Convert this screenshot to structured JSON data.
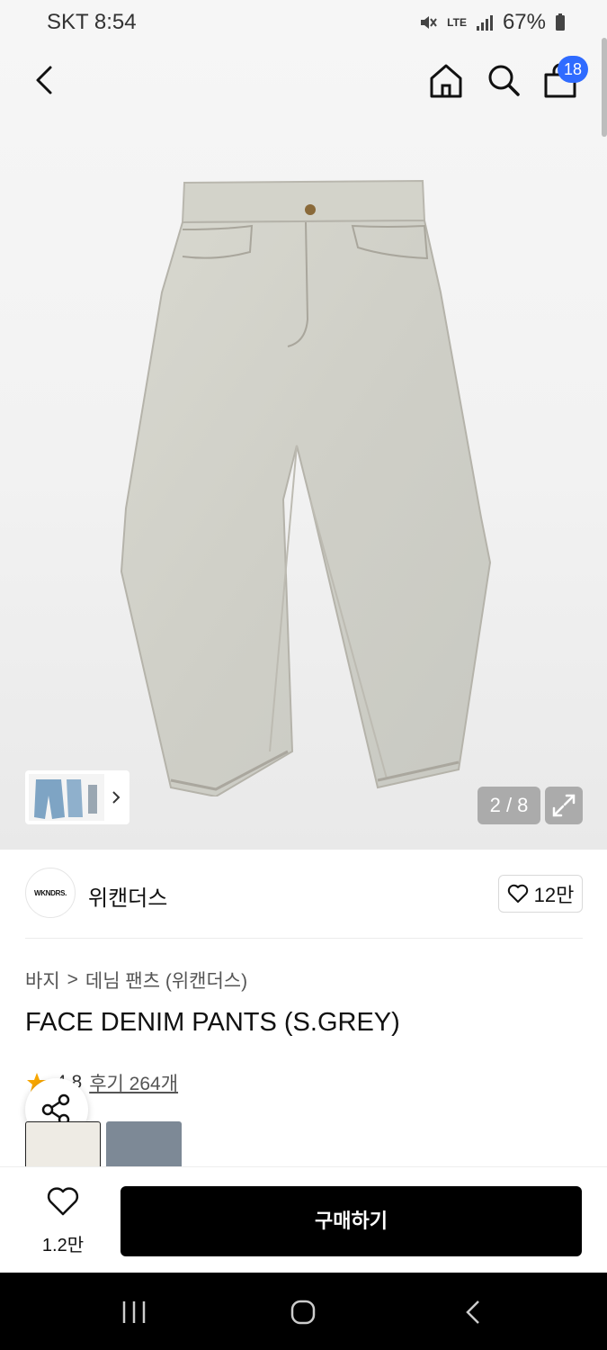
{
  "status_bar": {
    "carrier_time": "SKT 8:54",
    "network": "LTE",
    "battery": "67%"
  },
  "nav": {
    "cart_count": "18"
  },
  "gallery": {
    "counter": "2 / 8"
  },
  "brand": {
    "name": "위캔더스",
    "logo_text": "WKNDRS.",
    "likes": "12만"
  },
  "breadcrumb": {
    "level1": "바지",
    "separator": ">",
    "level2": "데님 팬츠 (위캔더스)"
  },
  "product": {
    "title": "FACE DENIM PANTS (S.GREY)",
    "rating": "4.8",
    "reviews": "후기 264개"
  },
  "action_bar": {
    "wish_count": "1.2만",
    "buy_label": "구매하기"
  },
  "colors": {
    "accent": "#2f6bff",
    "star": "#f7a600",
    "buy_button": "#000000"
  }
}
